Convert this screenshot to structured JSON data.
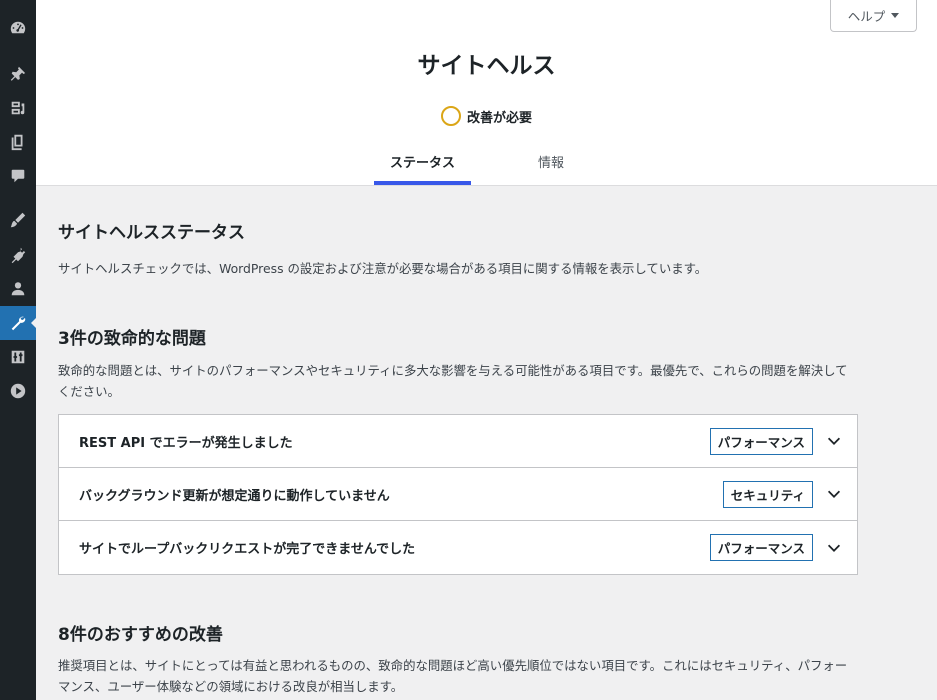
{
  "help": {
    "label": "ヘルプ"
  },
  "header": {
    "title": "サイトヘルス",
    "status_label": "改善が必要",
    "status_color": "#dba617",
    "tabs": [
      {
        "label": "ステータス",
        "active": true
      },
      {
        "label": "情報",
        "active": false
      }
    ]
  },
  "sidebar": {
    "icons": [
      "dashboard-icon",
      "pin-icon",
      "media-icon",
      "pages-icon",
      "comments-icon",
      "appearance-icon",
      "plugins-icon",
      "users-icon",
      "tools-icon",
      "settings-icon",
      "play-icon"
    ],
    "active": "tools-icon"
  },
  "main": {
    "heading": "サイトヘルスステータス",
    "intro": "サイトヘルスチェックでは、WordPress の設定および注意が必要な場合がある項目に関する情報を表示しています。",
    "critical": {
      "heading": "3件の致命的な問題",
      "description": "致命的な問題とは、サイトのパフォーマンスやセキュリティに多大な影響を与える可能性がある項目です。最優先で、これらの問題を解決してください。",
      "issues": [
        {
          "title": "REST API でエラーが発生しました",
          "badge": "パフォーマンス"
        },
        {
          "title": "バックグラウンド更新が想定通りに動作していません",
          "badge": "セキュリティ"
        },
        {
          "title": "サイトでループバックリクエストが完了できませんでした",
          "badge": "パフォーマンス"
        }
      ]
    },
    "recommended": {
      "heading": "8件のおすすめの改善",
      "description": "推奨項目とは、サイトにとっては有益と思われるものの、致命的な問題ほど高い優先順位ではない項目です。これにはセキュリティ、パフォーマンス、ユーザー体験などの領域における改良が相当します。"
    }
  },
  "colors": {
    "accent": "#2271b1",
    "tab_underline": "#3858e9",
    "sidebar_bg": "#1d2327"
  }
}
